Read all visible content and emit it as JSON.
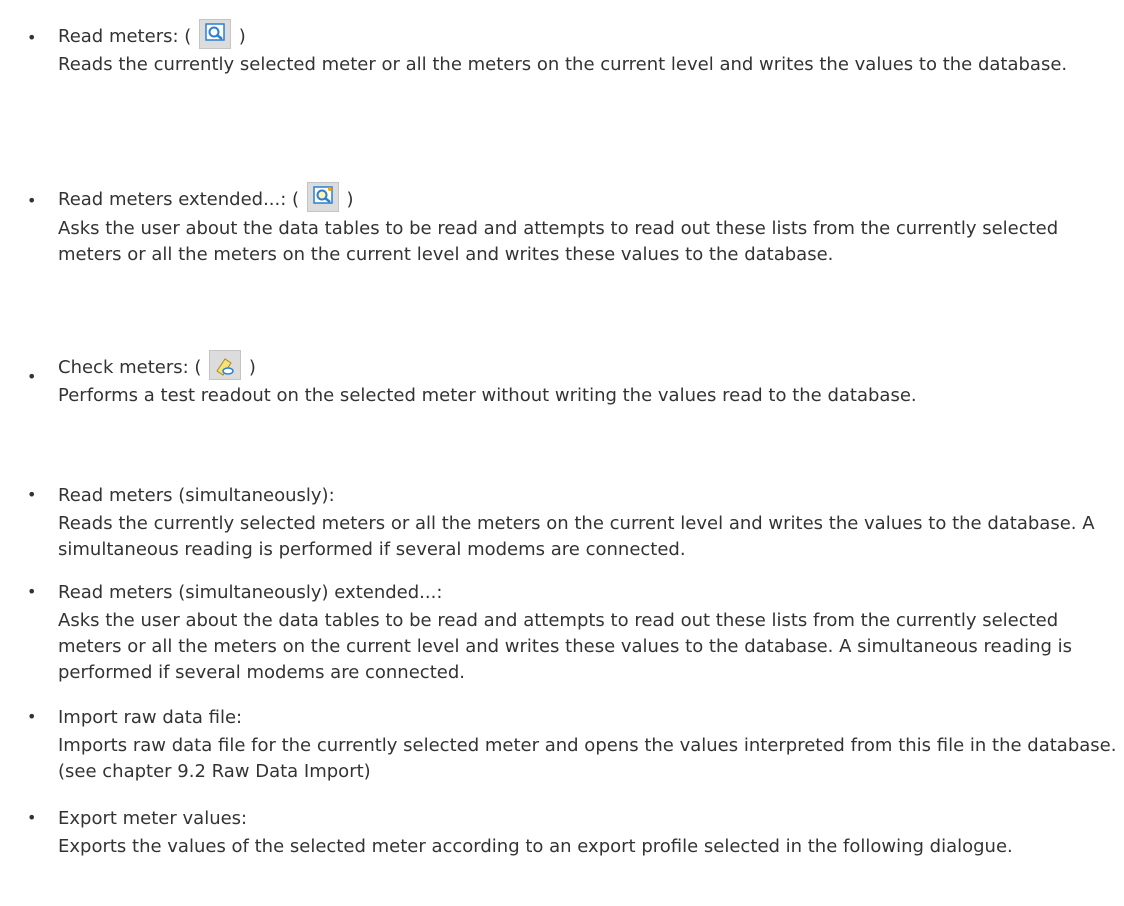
{
  "items": [
    {
      "title_prefix": "Read meters: ( ",
      "title_suffix": " )",
      "icon": "read-meters-icon",
      "description": "Reads the currently selected meter or all the meters on the current level and writes the values to the database."
    },
    {
      "title_prefix": "Read meters extended...: ( ",
      "title_suffix": " )",
      "icon": "read-meters-extended-icon",
      "description": "Asks the user about the data tables to be read and attempts to read out these lists from the currently selected meters or all the meters on the current level and writes these values to the database."
    },
    {
      "title_prefix": "Check meters: ( ",
      "title_suffix": " )",
      "icon": "check-meters-icon",
      "description": "Performs a test readout on the selected meter without writing the values read to the database."
    },
    {
      "title": "Read meters (simultaneously):",
      "description": "Reads the currently selected meters or all the meters on the current level and writes the values to the database. A simultaneous reading is performed if several modems are connected."
    },
    {
      "title": "Read meters (simultaneously) extended...:",
      "description": "Asks the user about the data tables to be read and attempts to read out these lists from the currently selected meters or all the meters on the current level and writes these values to the database. A simultaneous reading is performed if several modems are connected."
    },
    {
      "title": "Import raw data file:",
      "description": "Imports raw data file for the currently selected meter and opens the values interpreted from this file in the database. (see chapter 9.2 Raw Data Import)"
    },
    {
      "title": "Export meter values:",
      "description": "Exports the values of the selected meter according to an export profile selected in the following dialogue."
    }
  ],
  "bullet_char": "•",
  "colors": {
    "text": "#333333",
    "icon_bg": "#dcdcdc",
    "icon_accent": "#2a7fd4"
  }
}
